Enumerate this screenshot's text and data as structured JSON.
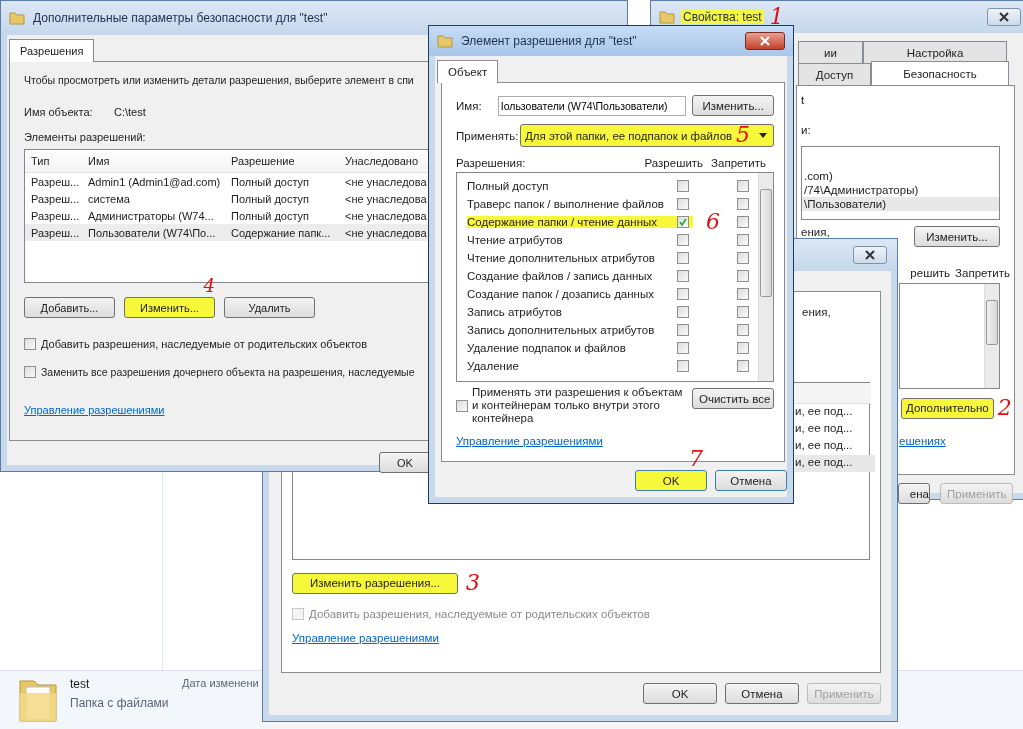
{
  "explorer": {
    "item_name": "test",
    "item_type": "Папка с файлами",
    "date_label": "Дата изменени"
  },
  "properties_window": {
    "title": "Свойства: test",
    "title_highlighted": true,
    "title_annotation": "1",
    "tabs": [
      {
        "label": "ии",
        "selected": false
      },
      {
        "label": "Настройка",
        "selected": false
      },
      {
        "label": "Доступ",
        "selected": false
      },
      {
        "label": "Безопасность",
        "selected": true
      }
    ],
    "object_fragment": "t",
    "group_label_fragment": "и:",
    "users": [
      {
        "name": ".com)",
        "selected": false
      },
      {
        "name": "/74\\Администраторы)",
        "selected": false
      },
      {
        "name": "\\Пользователи)",
        "selected": true
      }
    ],
    "note_fragment": "ения,",
    "edit_button": "Изменить...",
    "columns": [
      "решить",
      "Запретить"
    ],
    "advanced_button": {
      "label": "Дополнительно",
      "highlighted": true,
      "annotation": "2"
    },
    "link_fragment": "ешениях",
    "cancel_fragment": "ена",
    "apply_button": {
      "label": "Применить",
      "disabled": true
    }
  },
  "permissions_window": {
    "note_fragment": "ения,",
    "entries": [
      {
        "text": "и, ее под...",
        "selected": false
      },
      {
        "text": "и, ее под...",
        "selected": false
      },
      {
        "text": "и, ее под...",
        "selected": false
      },
      {
        "text": "и, ее под...",
        "selected": true
      }
    ],
    "change_button": {
      "label": "Изменить разрешения...",
      "highlighted": true,
      "annotation": "3"
    },
    "inherit_checkbox": {
      "label": "Добавить разрешения, наследуемые от родительских объектов",
      "checked": false,
      "disabled": true
    },
    "link": "Управление разрешениями",
    "buttons": [
      {
        "label": "OK",
        "disabled": false
      },
      {
        "label": "Отмена",
        "disabled": false
      },
      {
        "label": "Применить",
        "disabled": true
      }
    ]
  },
  "advanced_window": {
    "title": "Дополнительные параметры безопасности  для \"test\"",
    "tabs": [
      {
        "label": "Разрешения",
        "selected": true
      }
    ],
    "intro": "Чтобы просмотреть или изменить детали разрешения, выберите элемент в спи",
    "object_label": "Имя объекта:",
    "object_value": "C:\\test",
    "list_label": "Элементы разрешений:",
    "columns": [
      "Тип",
      "Имя",
      "Разрешение",
      "Унаследовано"
    ],
    "rows": [
      {
        "cells": [
          "Разреш...",
          "Admin1 (Admin1@ad.com)",
          "Полный доступ",
          "<не унаследова"
        ],
        "selected": false
      },
      {
        "cells": [
          "Разреш...",
          "система",
          "Полный доступ",
          "<не унаследова"
        ],
        "selected": false
      },
      {
        "cells": [
          "Разреш...",
          "Администраторы (W74...",
          "Полный доступ",
          "<не унаследова"
        ],
        "selected": false
      },
      {
        "cells": [
          "Разреш...",
          "Пользователи (W74\\По...",
          "Содержание папк...",
          "<не унаследова"
        ],
        "selected": true
      }
    ],
    "buttons": [
      {
        "label": "Добавить...",
        "highlighted": false
      },
      {
        "label": "Изменить...",
        "highlighted": true,
        "annotation": "4"
      },
      {
        "label": "Удалить",
        "highlighted": false
      }
    ],
    "checkboxes": [
      {
        "label": "Добавить разрешения, наследуемые от родительских объектов",
        "checked": false
      },
      {
        "label": "Заменить все разрешения дочернего объекта на разрешения, наследуемые",
        "checked": false
      }
    ],
    "link": "Управление разрешениями",
    "ok_button": "OK"
  },
  "entry_window": {
    "title": "Элемент разрешения для \"test\"",
    "tabs": [
      {
        "label": "Объект",
        "selected": true
      }
    ],
    "name_label": "Имя:",
    "name_value": "Iользователи (W74\\Пользователи)",
    "change_button": "Изменить...",
    "apply_label": "Применять:",
    "apply_value": {
      "text": "Для этой папки, ее подпапок и файлов",
      "highlighted": true,
      "annotation": "5"
    },
    "permissions_label": "Разрешения:",
    "columns": [
      "Разрешить",
      "Запретить"
    ],
    "rows": [
      {
        "name": "Полный доступ",
        "allow": false,
        "deny": false,
        "highlighted": false
      },
      {
        "name": "Траверс папок / выполнение файлов",
        "allow": false,
        "deny": false,
        "highlighted": false
      },
      {
        "name": "Содержание папки / чтение данных",
        "allow": true,
        "deny": false,
        "highlighted": true,
        "annotation": "6"
      },
      {
        "name": "Чтение атрибутов",
        "allow": false,
        "deny": false,
        "highlighted": false
      },
      {
        "name": "Чтение дополнительных атрибутов",
        "allow": false,
        "deny": false,
        "highlighted": false
      },
      {
        "name": "Создание файлов / запись данных",
        "allow": false,
        "deny": false,
        "highlighted": false
      },
      {
        "name": "Создание папок / дозапись данных",
        "allow": false,
        "deny": false,
        "highlighted": false
      },
      {
        "name": "Запись атрибутов",
        "allow": false,
        "deny": false,
        "highlighted": false
      },
      {
        "name": "Запись дополнительных атрибутов",
        "allow": false,
        "deny": false,
        "highlighted": false
      },
      {
        "name": "Удаление подпапок и файлов",
        "allow": false,
        "deny": false,
        "highlighted": false
      },
      {
        "name": "Удаление",
        "allow": false,
        "deny": false,
        "highlighted": false
      }
    ],
    "scope_checkbox": {
      "label": "Применять эти разрешения к объектам и контейнерам только внутри этого контейнера",
      "checked": false
    },
    "clear_button": "Очистить все",
    "link": "Управление разрешениями",
    "ok_button": {
      "label": "OK",
      "highlighted": true,
      "annotation": "7"
    },
    "cancel_button": "Отмена"
  }
}
